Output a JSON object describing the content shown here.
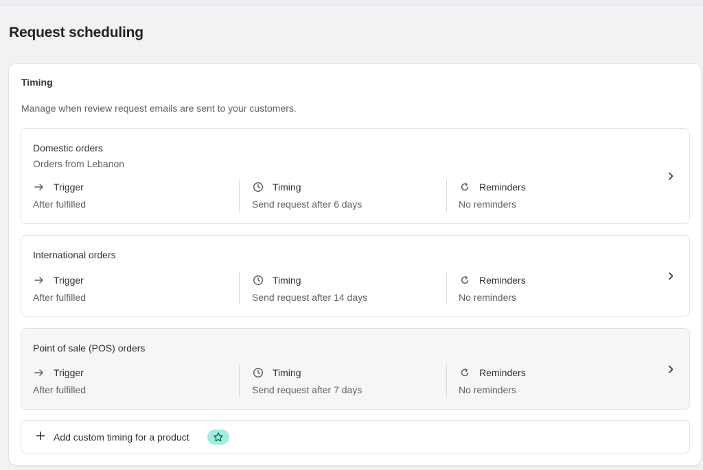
{
  "page": {
    "title": "Request scheduling"
  },
  "timing_card": {
    "title": "Timing",
    "description": "Manage when review request emails are sent to your customers."
  },
  "orders": [
    {
      "name": "Domestic orders",
      "subtitle": "Orders from Lebanon",
      "trigger_label": "Trigger",
      "trigger_value": "After fulfilled",
      "timing_label": "Timing",
      "timing_value": "Send request after 6 days",
      "reminders_label": "Reminders",
      "reminders_value": "No reminders"
    },
    {
      "name": "International orders",
      "trigger_label": "Trigger",
      "trigger_value": "After fulfilled",
      "timing_label": "Timing",
      "timing_value": "Send request after 14 days",
      "reminders_label": "Reminders",
      "reminders_value": "No reminders"
    },
    {
      "name": "Point of sale (POS) orders",
      "trigger_label": "Trigger",
      "trigger_value": "After fulfilled",
      "timing_label": "Timing",
      "timing_value": "Send request after 7 days",
      "reminders_label": "Reminders",
      "reminders_value": "No reminders"
    }
  ],
  "add_custom": {
    "label": "Add custom timing for a product",
    "badge_icon": "star-icon",
    "badge_color": "#9eede0"
  },
  "icons": {
    "trigger": "arrow-right-icon",
    "timing": "clock-icon",
    "reminders": "refresh-icon",
    "open": "chevron-right-icon"
  }
}
